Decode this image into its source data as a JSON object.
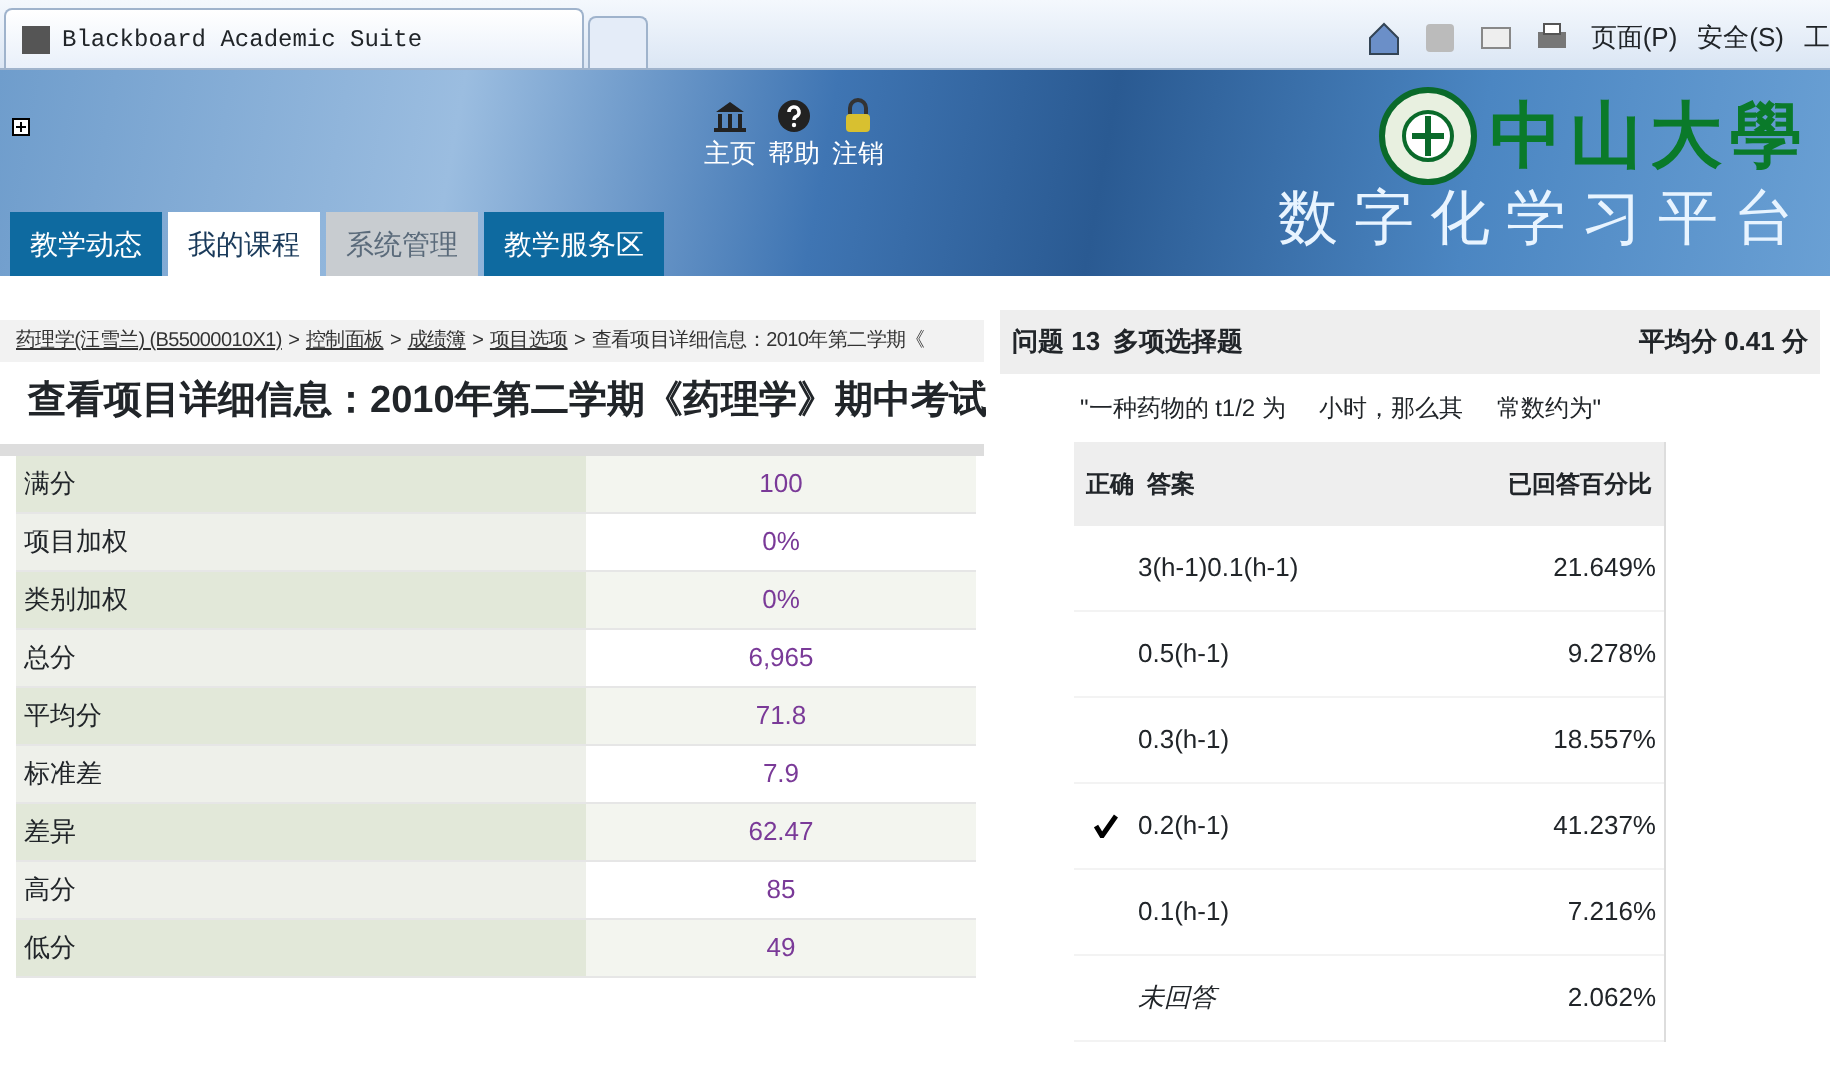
{
  "browser": {
    "tab_title": "Blackboard Academic Suite",
    "toolbar": [
      {
        "kind": "home"
      },
      {
        "kind": "feed"
      },
      {
        "kind": "mail"
      },
      {
        "kind": "print"
      },
      {
        "kind": "menu",
        "label": "页面(P)"
      },
      {
        "kind": "menu",
        "label": "安全(S)"
      },
      {
        "kind": "menu",
        "label": "工"
      }
    ]
  },
  "header": {
    "links": [
      {
        "kind": "home",
        "label": "主页"
      },
      {
        "kind": "help",
        "label": "帮助"
      },
      {
        "kind": "logout",
        "label": "注销"
      }
    ],
    "tabs": [
      {
        "label": "教学动态",
        "selected": false,
        "disabled": false
      },
      {
        "label": "我的课程",
        "selected": true,
        "disabled": false
      },
      {
        "label": "系统管理",
        "selected": false,
        "disabled": true
      },
      {
        "label": "教学服务区",
        "selected": false,
        "disabled": false
      }
    ],
    "logo": {
      "name": "中山大學",
      "subtitle": "数字化学习平台"
    }
  },
  "breadcrumb": [
    {
      "label": "药理学(汪雪兰) (B55000010X1)",
      "link": true
    },
    {
      "separator": ">",
      "label": "控制面板",
      "link": true
    },
    {
      "separator": ">",
      "label": "成绩簿",
      "link": true
    },
    {
      "separator": ">",
      "label": "项目选项",
      "link": true
    },
    {
      "separator": ">",
      "label": "查看项目详细信息：2010年第二学期《",
      "link": false
    }
  ],
  "page_title": "查看项目详细信息：2010年第二学期《药理学》期中考试",
  "stats": [
    {
      "label": "满分",
      "value": "100"
    },
    {
      "label": "项目加权",
      "value": "0%"
    },
    {
      "label": "类别加权",
      "value": "0%"
    },
    {
      "label": "总分",
      "value": "6,965"
    },
    {
      "label": "平均分",
      "value": "71.8"
    },
    {
      "label": "标准差",
      "value": "7.9"
    },
    {
      "label": "差异",
      "value": "62.47"
    },
    {
      "label": "高分",
      "value": "85"
    },
    {
      "label": "低分",
      "value": "49"
    }
  ],
  "question": {
    "number_label": "问题 13",
    "type": "多项选择题",
    "average": "平均分 0.41 分",
    "text": "\"一种药物的 t1/2 为     小时，那么其     常数约为\"",
    "columns": [
      "正确",
      "答案",
      "已回答百分比"
    ],
    "answers": [
      {
        "kind": "answer",
        "text": "3(h-1)0.1(h-1)",
        "percent": "21.649%",
        "correct": false
      },
      {
        "kind": "answer",
        "text": "0.5(h-1)",
        "percent": "9.278%",
        "correct": false
      },
      {
        "kind": "answer",
        "text": "0.3(h-1)",
        "percent": "18.557%",
        "correct": false
      },
      {
        "kind": "answer",
        "text": "0.2(h-1)",
        "percent": "41.237%",
        "correct": true
      },
      {
        "kind": "answer",
        "text": "0.1(h-1)",
        "percent": "7.216%",
        "correct": false
      },
      {
        "kind": "unanswered",
        "text": "未回答",
        "percent": "2.062%",
        "correct": false
      }
    ]
  }
}
